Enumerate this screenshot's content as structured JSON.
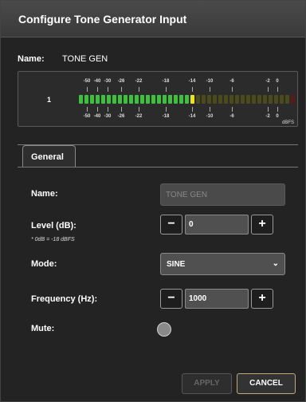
{
  "dialog": {
    "title": "Configure Tone Generator Input",
    "name_label": "Name:",
    "name_value": "TONE GEN"
  },
  "meter": {
    "channel": "1",
    "scale_labels": [
      "-50",
      "-40",
      "-30",
      "-26",
      "-22",
      "-18",
      "-14",
      "-10",
      "-6",
      "-2",
      "0"
    ],
    "unit": "dBFS",
    "level_dbfs": -18,
    "colors": {
      "green": "#3fbf3f",
      "yellow": "#f0e020",
      "dim": "#4a4a1a",
      "red_dim": "#5a1a1a"
    }
  },
  "tabs": [
    {
      "label": "General"
    }
  ],
  "form": {
    "name_label": "Name:",
    "name_placeholder": "TONE GEN",
    "level_label": "Level (dB):",
    "level_note": "* 0dB = -18 dBFS",
    "level_value": "0",
    "mode_label": "Mode:",
    "mode_value": "SINE",
    "frequency_label": "Frequency (Hz):",
    "frequency_value": "1000",
    "mute_label": "Mute:",
    "minus": "−",
    "plus": "+"
  },
  "footer": {
    "apply_label": "APPLY",
    "cancel_label": "CANCEL"
  }
}
